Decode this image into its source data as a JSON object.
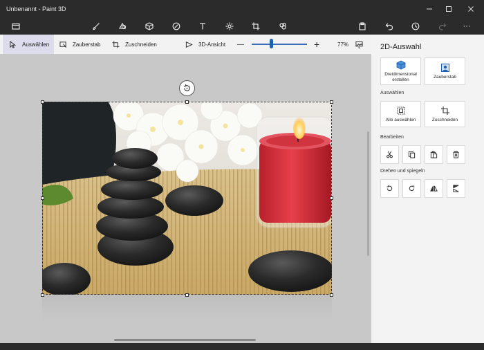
{
  "window": {
    "title": "Unbenannt - Paint 3D",
    "controls": [
      "minimize-icon",
      "maximize-icon",
      "close-icon"
    ]
  },
  "toolbar": {
    "tools": [
      "folder-icon",
      "brush-icon",
      "shapes-2d-icon",
      "shapes-3d-icon",
      "stickers-icon",
      "text-icon",
      "effects-icon",
      "canvas-icon",
      "3d-library-icon"
    ],
    "right_tools": [
      "paste-icon",
      "undo-icon",
      "history-icon",
      "redo-icon",
      "more-icon"
    ],
    "more_label": "···"
  },
  "commandbar": {
    "select_label": "Auswählen",
    "magic_select_label": "Zauberstab",
    "crop_label": "Zuschneiden",
    "view3d_label": "3D-Ansicht",
    "zoom_minus": "—",
    "zoom_plus": "+",
    "zoom_value": "77%",
    "zoom_level": 0.35
  },
  "panel": {
    "title": "2D-Auswahl",
    "make3d_label": "Dreidimensional erstellen",
    "magic_label": "Zauberstab",
    "select_section": "Auswählen",
    "select_all_label": "Alle auswählen",
    "crop_label": "Zuschneiden",
    "edit_section": "Bearbeiten",
    "edit_buttons": [
      "cut-icon",
      "copy-icon",
      "paste-icon",
      "delete-icon"
    ],
    "rotate_section": "Drehen und spiegeln",
    "rotate_buttons": [
      "rotate-left-icon",
      "rotate-right-icon",
      "flip-vertical-icon",
      "flip-horizontal-icon"
    ],
    "accent": "#1e5fb0"
  }
}
